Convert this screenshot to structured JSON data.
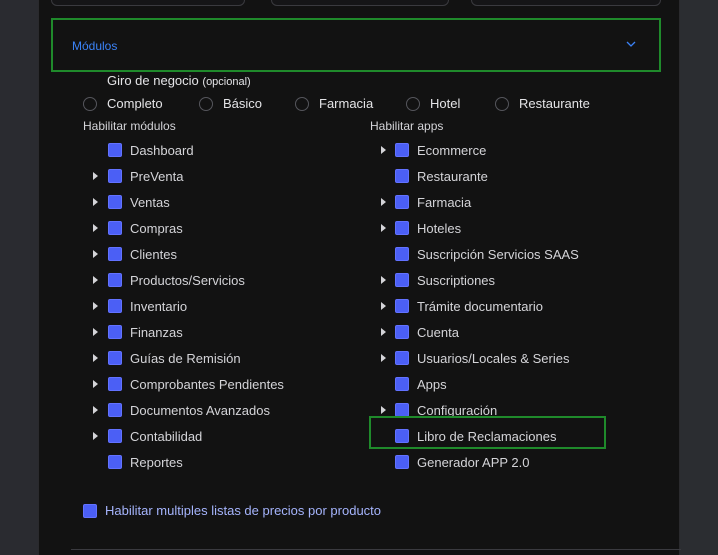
{
  "modulos": {
    "title": "Módulos",
    "chevron_icon": "chevron-down-icon",
    "accent_color": "#3b82f6"
  },
  "giro": {
    "label": "Giro de negocio",
    "optional": "(opcional)",
    "options": [
      "Completo",
      "Básico",
      "Farmacia",
      "Hotel",
      "Restaurante"
    ]
  },
  "modules": {
    "title": "Habilitar módulos",
    "items": [
      {
        "label": "Dashboard",
        "expandable": false
      },
      {
        "label": "PreVenta",
        "expandable": true
      },
      {
        "label": "Ventas",
        "expandable": true
      },
      {
        "label": "Compras",
        "expandable": true
      },
      {
        "label": "Clientes",
        "expandable": true
      },
      {
        "label": "Productos/Servicios",
        "expandable": true
      },
      {
        "label": "Inventario",
        "expandable": true
      },
      {
        "label": "Finanzas",
        "expandable": true
      },
      {
        "label": "Guías de Remisión",
        "expandable": true
      },
      {
        "label": "Comprobantes Pendientes",
        "expandable": true
      },
      {
        "label": "Documentos Avanzados",
        "expandable": true
      },
      {
        "label": "Contabilidad",
        "expandable": true
      },
      {
        "label": "Reportes",
        "expandable": false
      }
    ]
  },
  "apps": {
    "title": "Habilitar apps",
    "items": [
      {
        "label": "Ecommerce",
        "expandable": true
      },
      {
        "label": "Restaurante",
        "expandable": false
      },
      {
        "label": "Farmacia",
        "expandable": true
      },
      {
        "label": "Hoteles",
        "expandable": true
      },
      {
        "label": "Suscripción Servicios SAAS",
        "expandable": false
      },
      {
        "label": "Suscriptiones",
        "expandable": true
      },
      {
        "label": "Trámite documentario",
        "expandable": true
      },
      {
        "label": "Cuenta",
        "expandable": true
      },
      {
        "label": "Usuarios/Locales & Series",
        "expandable": true
      },
      {
        "label": "Apps",
        "expandable": false
      },
      {
        "label": "Configuración",
        "expandable": true
      },
      {
        "label": "Libro de Reclamaciones",
        "expandable": false
      },
      {
        "label": "Generador APP 2.0",
        "expandable": false
      }
    ]
  },
  "precios": {
    "label": "Habilitar multiples listas de precios por producto"
  },
  "colors": {
    "checkbox": "#4b5ff5",
    "highlight": "#1f8a2b",
    "panel": "#121212"
  }
}
